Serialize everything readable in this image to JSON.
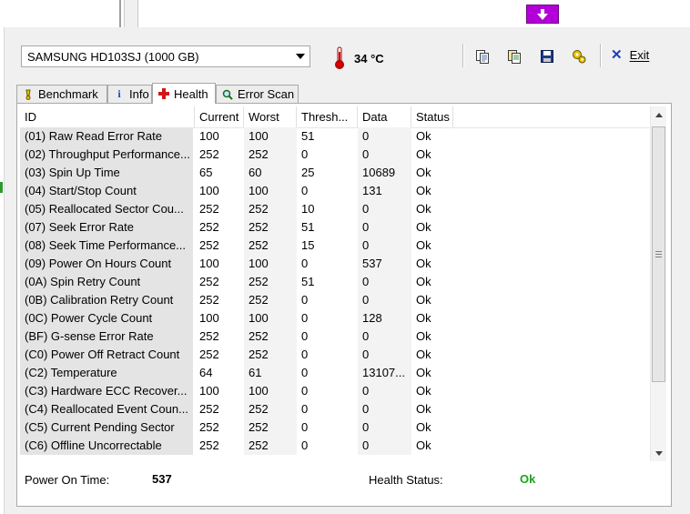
{
  "drive": {
    "name": "SAMSUNG HD103SJ (1000 GB)"
  },
  "temperature": {
    "value": "34 °C"
  },
  "toolbar": {
    "exit_label": "Exit",
    "icons": [
      "copy-icon",
      "copy-all-icon",
      "save-icon",
      "options-icon",
      "exit-icon"
    ]
  },
  "tabs": [
    {
      "label": "Benchmark",
      "icon": "benchmark-icon"
    },
    {
      "label": "Info",
      "icon": "info-icon"
    },
    {
      "label": "Health",
      "icon": "health-icon",
      "active": true
    },
    {
      "label": "Error Scan",
      "icon": "error-scan-icon"
    }
  ],
  "table": {
    "columns": [
      "ID",
      "Current",
      "Worst",
      "Thresh...",
      "Data",
      "Status"
    ],
    "rows": [
      [
        "(01) Raw Read Error Rate",
        "100",
        "100",
        "51",
        "0",
        "Ok"
      ],
      [
        "(02) Throughput Performance...",
        "252",
        "252",
        "0",
        "0",
        "Ok"
      ],
      [
        "(03) Spin Up Time",
        "65",
        "60",
        "25",
        "10689",
        "Ok"
      ],
      [
        "(04) Start/Stop Count",
        "100",
        "100",
        "0",
        "131",
        "Ok"
      ],
      [
        "(05) Reallocated Sector Cou...",
        "252",
        "252",
        "10",
        "0",
        "Ok"
      ],
      [
        "(07) Seek Error Rate",
        "252",
        "252",
        "51",
        "0",
        "Ok"
      ],
      [
        "(08) Seek Time Performance...",
        "252",
        "252",
        "15",
        "0",
        "Ok"
      ],
      [
        "(09) Power On Hours Count",
        "100",
        "100",
        "0",
        "537",
        "Ok"
      ],
      [
        "(0A) Spin Retry Count",
        "252",
        "252",
        "51",
        "0",
        "Ok"
      ],
      [
        "(0B) Calibration Retry Count",
        "252",
        "252",
        "0",
        "0",
        "Ok"
      ],
      [
        "(0C) Power Cycle Count",
        "100",
        "100",
        "0",
        "128",
        "Ok"
      ],
      [
        "(BF) G-sense Error Rate",
        "252",
        "252",
        "0",
        "0",
        "Ok"
      ],
      [
        "(C0) Power Off Retract Count",
        "252",
        "252",
        "0",
        "0",
        "Ok"
      ],
      [
        "(C2) Temperature",
        "64",
        "61",
        "0",
        "13107...",
        "Ok"
      ],
      [
        "(C3) Hardware ECC Recover...",
        "100",
        "100",
        "0",
        "0",
        "Ok"
      ],
      [
        "(C4) Reallocated Event Coun...",
        "252",
        "252",
        "0",
        "0",
        "Ok"
      ],
      [
        "(C5) Current Pending Sector",
        "252",
        "252",
        "0",
        "0",
        "Ok"
      ],
      [
        "(C6) Offline Uncorrectable",
        "252",
        "252",
        "0",
        "0",
        "Ok"
      ]
    ]
  },
  "footer": {
    "power_on_label": "Power On Time:",
    "power_on_value": "537",
    "health_label": "Health Status:",
    "health_value": "Ok",
    "health_color": "#1aa51a"
  }
}
